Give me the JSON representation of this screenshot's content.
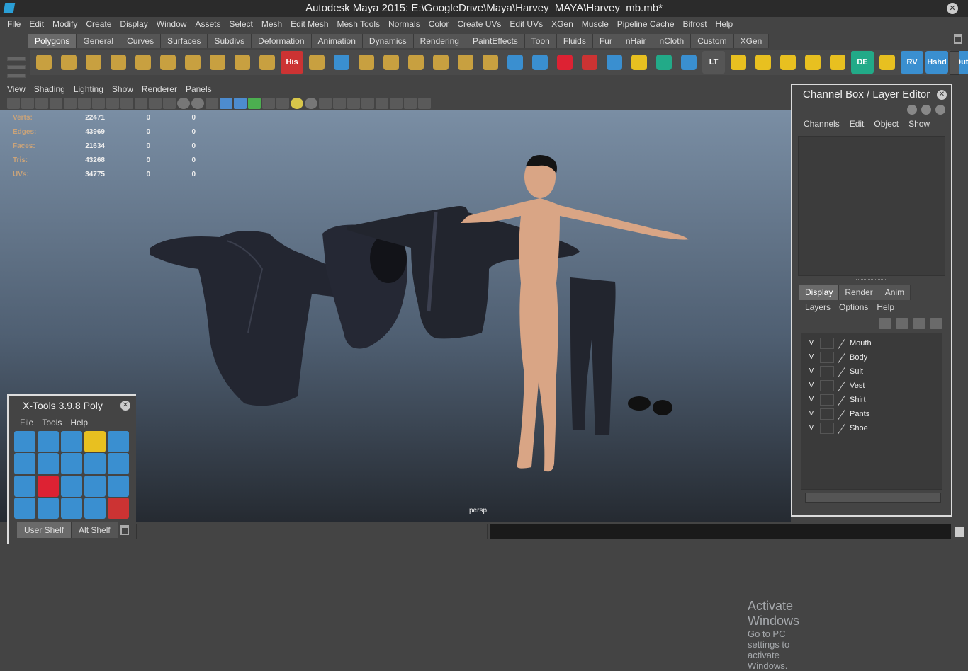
{
  "window": {
    "title": "Autodesk Maya 2015: E:\\GoogleDrive\\Maya\\Harvey_MAYA\\Harvey_mb.mb*"
  },
  "menu": [
    "File",
    "Edit",
    "Modify",
    "Create",
    "Display",
    "Window",
    "Assets",
    "Select",
    "Mesh",
    "Edit Mesh",
    "Mesh Tools",
    "Normals",
    "Color",
    "Create UVs",
    "Edit UVs",
    "XGen",
    "Muscle",
    "Pipeline Cache",
    "Bifrost",
    "Help"
  ],
  "shelf_tabs": [
    "Polygons",
    "General",
    "Curves",
    "Surfaces",
    "Subdivs",
    "Deformation",
    "Animation",
    "Dynamics",
    "Rendering",
    "PaintEffects",
    "Toon",
    "Fluids",
    "Fur",
    "nHair",
    "nCloth",
    "Custom",
    "XGen"
  ],
  "shelf_active": "Polygons",
  "shelf_icons": [
    {
      "name": "sphere-icon",
      "color": "#c8a040",
      "label": ""
    },
    {
      "name": "cube-icon",
      "color": "#c8a040",
      "label": ""
    },
    {
      "name": "cylinder-icon",
      "color": "#c8a040",
      "label": ""
    },
    {
      "name": "cone-icon",
      "color": "#c8a040",
      "label": ""
    },
    {
      "name": "plane-icon",
      "color": "#c8a040",
      "label": ""
    },
    {
      "name": "torus-icon",
      "color": "#c8a040",
      "label": ""
    },
    {
      "name": "pyramid-icon",
      "color": "#c8a040",
      "label": ""
    },
    {
      "name": "pipe-icon",
      "color": "#c8a040",
      "label": ""
    },
    {
      "name": "combine-icon",
      "color": "#c8a040",
      "label": ""
    },
    {
      "name": "smooth-icon",
      "color": "#c8a040",
      "label": ""
    },
    {
      "name": "history-icon",
      "color": "#c33",
      "label": "His"
    },
    {
      "name": "extrude-icon",
      "color": "#c8a040",
      "label": ""
    },
    {
      "name": "bridge-icon",
      "color": "#3a8fd0",
      "label": ""
    },
    {
      "name": "append-icon",
      "color": "#c8a040",
      "label": ""
    },
    {
      "name": "split-icon",
      "color": "#c8a040",
      "label": ""
    },
    {
      "name": "insert-edge-icon",
      "color": "#c8a040",
      "label": ""
    },
    {
      "name": "offset-edge-icon",
      "color": "#c8a040",
      "label": ""
    },
    {
      "name": "merge-icon",
      "color": "#c8a040",
      "label": ""
    },
    {
      "name": "collapse-icon",
      "color": "#c8a040",
      "label": ""
    },
    {
      "name": "planar-mapping-icon",
      "color": "#3a8fd0",
      "label": ""
    },
    {
      "name": "cylindrical-mapping-icon",
      "color": "#3a8fd0",
      "label": ""
    },
    {
      "name": "sculpt-icon",
      "color": "#d23",
      "label": ""
    },
    {
      "name": "paint-icon",
      "color": "#c33",
      "label": ""
    },
    {
      "name": "lattice-icon",
      "color": "#3a8fd0",
      "label": ""
    },
    {
      "name": "target-icon",
      "color": "#e8c020",
      "label": ""
    },
    {
      "name": "transform-icon",
      "color": "#2a8",
      "label": ""
    },
    {
      "name": "cube-blue-icon",
      "color": "#3a8fd0",
      "label": ""
    },
    {
      "name": "lt-icon",
      "color": "#555",
      "label": "LT"
    },
    {
      "name": "uv-layout-icon",
      "color": "#e8c020",
      "label": ""
    },
    {
      "name": "uv-cut-icon",
      "color": "#e8c020",
      "label": ""
    },
    {
      "name": "uv-sew-icon",
      "color": "#e8c020",
      "label": ""
    },
    {
      "name": "uv-move-icon",
      "color": "#e8c020",
      "label": ""
    },
    {
      "name": "uv-unfold-icon",
      "color": "#e8c020",
      "label": ""
    },
    {
      "name": "de-icon",
      "color": "#2a8",
      "label": "DE"
    },
    {
      "name": "uv-relax-icon",
      "color": "#e8c020",
      "label": ""
    },
    {
      "name": "rv-icon",
      "color": "#3a8fd0",
      "label": "RV"
    },
    {
      "name": "hshd-icon",
      "color": "#3a8fd0",
      "label": "Hshd"
    },
    {
      "name": "out-icon",
      "color": "#3a8fd0",
      "label": "Out"
    }
  ],
  "viewport_menu": [
    "View",
    "Shading",
    "Lighting",
    "Show",
    "Renderer",
    "Panels"
  ],
  "viewport_tools": [
    "",
    "",
    "",
    "",
    "",
    "",
    "",
    "",
    "",
    "",
    "",
    "",
    "r",
    "r",
    "",
    "b",
    "b",
    "g",
    "",
    "",
    "y",
    "r",
    "",
    "",
    "",
    "",
    "",
    "",
    "",
    ""
  ],
  "hud": [
    {
      "label": "Verts:",
      "v1": "22471",
      "v2": "0",
      "v3": "0"
    },
    {
      "label": "Edges:",
      "v1": "43969",
      "v2": "0",
      "v3": "0"
    },
    {
      "label": "Faces:",
      "v1": "21634",
      "v2": "0",
      "v3": "0"
    },
    {
      "label": "Tris:",
      "v1": "43268",
      "v2": "0",
      "v3": "0"
    },
    {
      "label": "UVs:",
      "v1": "34775",
      "v2": "0",
      "v3": "0"
    }
  ],
  "camera_label": "persp",
  "channel_box": {
    "title": "Channel Box / Layer Editor",
    "menu": [
      "Channels",
      "Edit",
      "Object",
      "Show"
    ],
    "layer_tabs": [
      "Display",
      "Render",
      "Anim"
    ],
    "layer_tab_active": "Display",
    "layer_menu": [
      "Layers",
      "Options",
      "Help"
    ],
    "layers": [
      {
        "vis": "V",
        "name": "Mouth"
      },
      {
        "vis": "V",
        "name": "Body"
      },
      {
        "vis": "V",
        "name": "Suit"
      },
      {
        "vis": "V",
        "name": "Vest"
      },
      {
        "vis": "V",
        "name": "Shirt"
      },
      {
        "vis": "V",
        "name": "Pants"
      },
      {
        "vis": "V",
        "name": "Shoe"
      }
    ]
  },
  "xtools": {
    "title": "X-Tools 3.9.8 Poly",
    "menu": [
      "File",
      "Tools",
      "Help"
    ],
    "icons": [
      "#3a8fd0",
      "#3a8fd0",
      "#3a8fd0",
      "#e8c020",
      "#3a8fd0",
      "#3a8fd0",
      "#3a8fd0",
      "#3a8fd0",
      "#3a8fd0",
      "#3a8fd0",
      "#3a8fd0",
      "#d23",
      "#3a8fd0",
      "#3a8fd0",
      "#3a8fd0",
      "#3a8fd0",
      "#3a8fd0",
      "#3a8fd0",
      "#3a8fd0",
      "#c33"
    ],
    "tabs": [
      "User Shelf",
      "Alt Shelf"
    ],
    "tab_active": "User Shelf"
  },
  "watermark": {
    "line1": "Activate Windows",
    "line2": "Go to PC settings to activate Windows."
  }
}
